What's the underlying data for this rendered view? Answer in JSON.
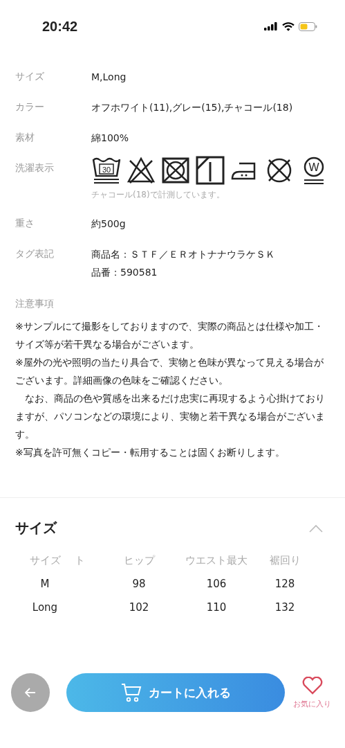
{
  "status_bar": {
    "time": "20:42"
  },
  "specs": [
    {
      "kind": "text",
      "label": "サイズ",
      "lines": [
        "M,Long"
      ]
    },
    {
      "kind": "text",
      "label": "カラー",
      "lines": [
        "オフホワイト(11),グレー(15),チャコール(18)"
      ]
    },
    {
      "kind": "text",
      "label": "素材",
      "lines": [
        "綿100%"
      ]
    },
    {
      "kind": "care",
      "label": "洗濯表示",
      "symbols": [
        {
          "kind": "wash",
          "text": "30"
        },
        {
          "kind": "no_bleach"
        },
        {
          "kind": "no_tumble"
        },
        {
          "kind": "shade_dry"
        },
        {
          "kind": "iron"
        },
        {
          "kind": "no_dry_clean"
        },
        {
          "kind": "wet_clean",
          "text": "W"
        }
      ],
      "note": "チャコール(18)で計測しています。"
    },
    {
      "kind": "text",
      "label": "重さ",
      "lines": [
        "約500g"
      ]
    },
    {
      "kind": "text",
      "label": "タグ表記",
      "lines": [
        "商品名：ＳＴＦ／ＥＲオトナナウラケＳＫ",
        "品番：590581"
      ]
    }
  ],
  "notes": {
    "heading": "注意事項",
    "paragraphs": [
      "※サンプルにて撮影をしておりますので、実際の商品とは仕様や加工・サイズ等が若干異なる場合がございます。",
      "※屋外の光や照明の当たり具合で、実物と色味が異なって見える場合がございます。詳細画像の色味をご確認ください。",
      "　なお、商品の色や質感を出来るだけ忠実に再現するよう心掛けておりますが、パソコンなどの環境により、実物と若干異なる場合がございます。",
      "※写真を許可無くコピー・転用することは固くお断りします。"
    ]
  },
  "size_section": {
    "title": "サイズ",
    "expanded": true,
    "columns": [
      "サイズ",
      "ト",
      "ヒップ",
      "ウエスト最大",
      "裾回り"
    ],
    "rows": [
      {
        "size": "M",
        "values": [
          "98",
          "106",
          "128"
        ]
      },
      {
        "size": "Long",
        "values": [
          "102",
          "110",
          "132"
        ]
      }
    ]
  },
  "bottom_bar": {
    "cart_button": "カートに入れる",
    "favorite": {
      "label": "お気に入り",
      "on": false
    }
  }
}
